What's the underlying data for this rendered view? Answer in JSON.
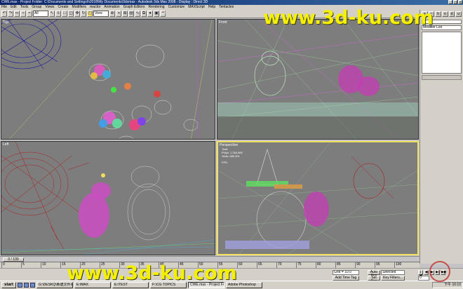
{
  "window": {
    "title": "CWE.max - Project Folder: C:\\Documents and Settings\\h2018\\My Documents\\3dsmax - Autodesk 3ds Max 2008 - Display : Direct 3D",
    "buttons": [
      "_",
      "□",
      "×"
    ]
  },
  "menubar": [
    "File",
    "Edit",
    "Tools",
    "Group",
    "Views",
    "Create",
    "Modifiers",
    "reactor",
    "Animation",
    "Graph Editors",
    "Rendering",
    "Customize",
    "MAXScript",
    "Help",
    "Tentacles"
  ],
  "toolbar": {
    "selection_filter": "All",
    "view_dropdown": "View",
    "icons": [
      "undo-icon",
      "redo-icon",
      "link-icon",
      "unlink-icon",
      "bind-icon",
      "select-icon",
      "select-by-name-icon",
      "rect-select-icon",
      "window-crossing-icon",
      "move-icon",
      "rotate-icon",
      "scale-icon",
      "pivot-icon",
      "mirror-icon",
      "align-icon",
      "layer-icon",
      "curve-editor-icon",
      "schematic-icon",
      "material-icon",
      "render-setup-icon",
      "render-icon"
    ]
  },
  "viewports": [
    {
      "name": "top",
      "label": "Top"
    },
    {
      "name": "front",
      "label": "Front"
    },
    {
      "name": "left",
      "label": "Left"
    },
    {
      "name": "perspective",
      "label": "Perspective",
      "stats": [
        "Total",
        "Polys: 1,354,982",
        "Verts: 680,301"
      ],
      "fps": "FPS:"
    }
  ],
  "command_panel": {
    "tabs": [
      "+",
      "~",
      "h",
      "o",
      "d",
      "u"
    ],
    "modifier_list": "Modifier List"
  },
  "timeline": {
    "slider": "0 / 100",
    "ticks": [
      "0",
      "5",
      "10",
      "15",
      "20",
      "25",
      "30",
      "35",
      "40",
      "45",
      "50",
      "55",
      "60",
      "65",
      "70",
      "75",
      "80",
      "85",
      "90",
      "95",
      "100"
    ]
  },
  "statusbar": {
    "grid": "Grid = 10.0",
    "add_time_tag": "Add Time Tag",
    "auto_key": "Auto Key",
    "set_key": "Set Key",
    "key_mode": "Selected",
    "key_filters": "Key Filters...",
    "frame": "0"
  },
  "taskbar": {
    "start": "start",
    "tasks": [
      "G:\\DESKQ\\新建文件夹",
      "E:\\MAX",
      "E:\\TEST",
      "F:\\CG TOPICS",
      "CWE.max - Project Fo...",
      "Adobe Photoshop"
    ],
    "active_task": 4,
    "clock": "下午 10:10"
  },
  "watermark": {
    "text1": "www.3d-ku.com",
    "text2": "www.3d-ku.com"
  }
}
